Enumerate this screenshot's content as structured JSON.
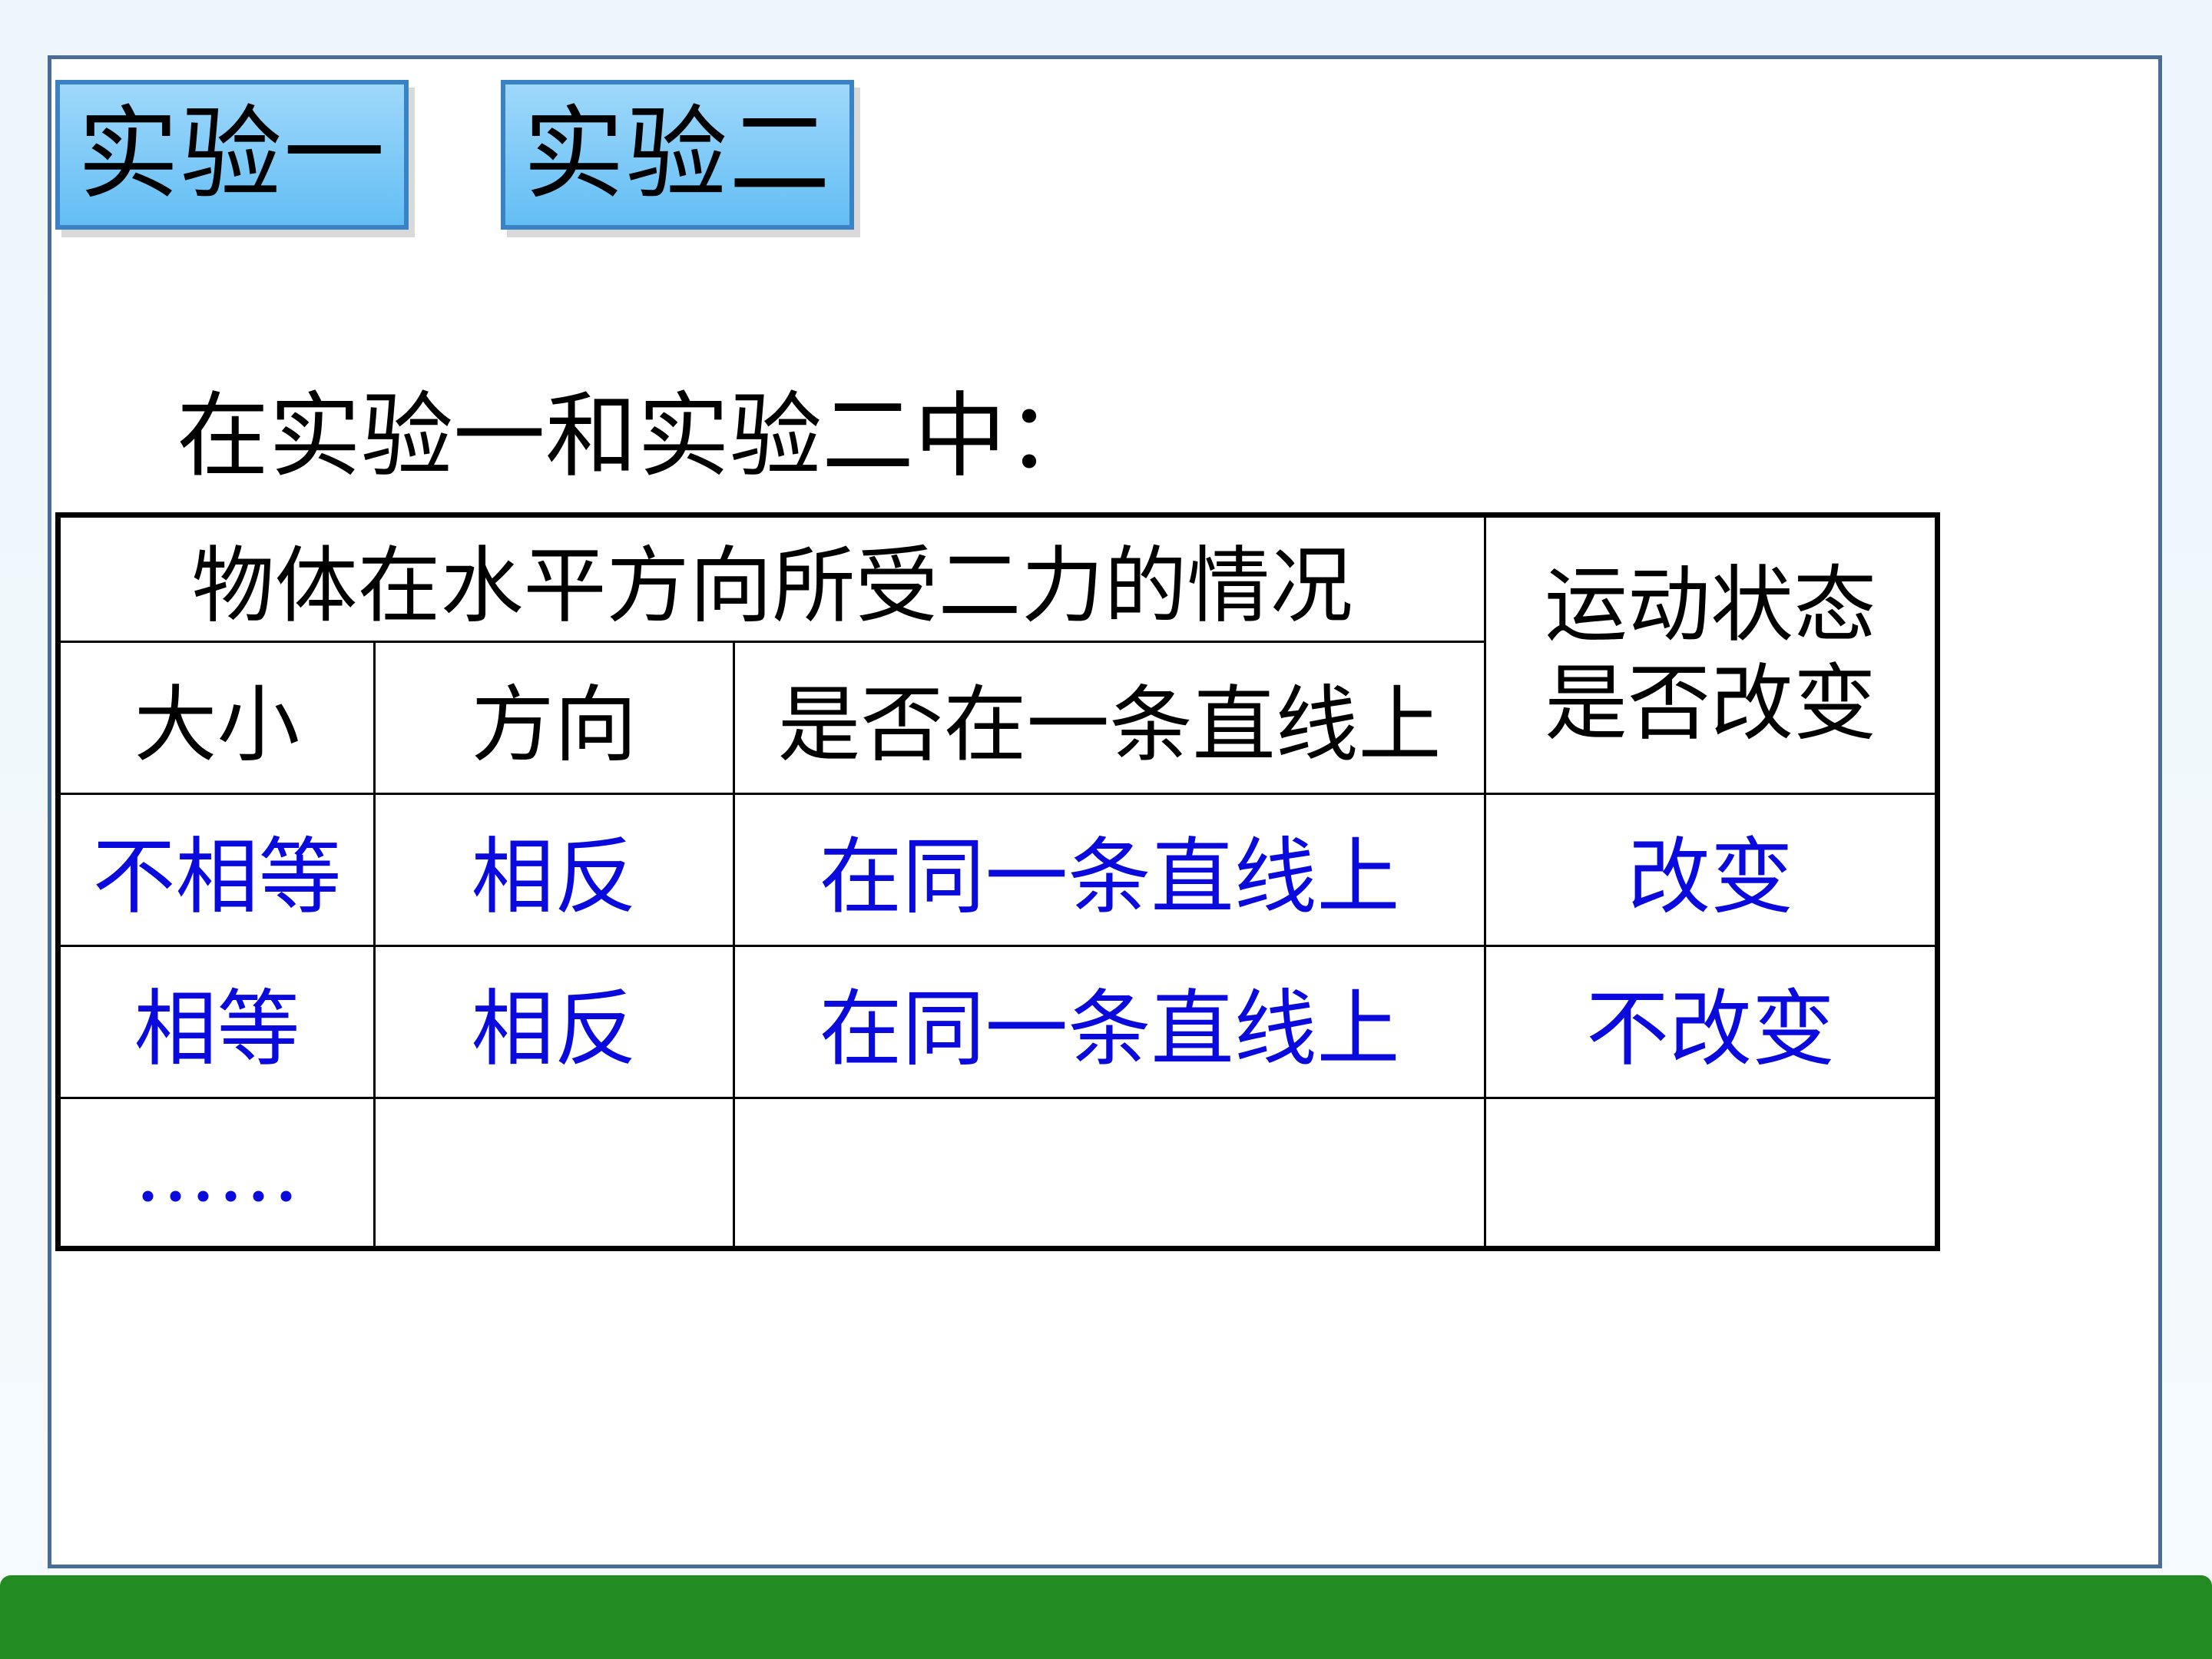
{
  "buttons": {
    "exp1": "实验一",
    "exp2": "实验二"
  },
  "intro": "在实验一和实验二中：",
  "table": {
    "group_header": "物体在水平方向所受二力的情况",
    "state_header_line1": "运动状态",
    "state_header_line2": "是否改变",
    "columns": [
      "大小",
      "方向",
      "是否在一条直线上"
    ],
    "rows": [
      [
        "不相等",
        "相反",
        "在同一条直线上",
        "改变"
      ],
      [
        "相等",
        "相反",
        "在同一条直线上",
        "不改变"
      ],
      [
        "……",
        "",
        "",
        ""
      ]
    ]
  },
  "colors": {
    "value_text": "#0a0adc",
    "button_fill": "#63bef5",
    "footer": "#228b22"
  }
}
